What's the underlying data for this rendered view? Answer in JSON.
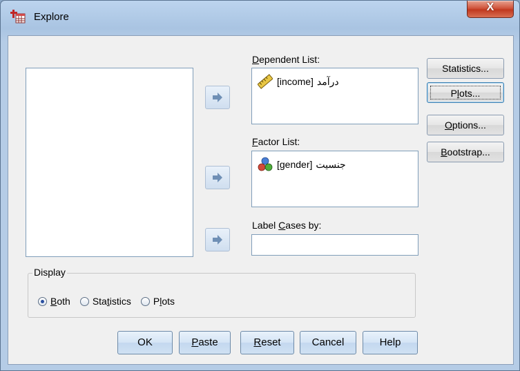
{
  "window": {
    "title": "Explore",
    "close_glyph": "X"
  },
  "source_list": {
    "items": []
  },
  "dependent_list": {
    "label_pre": "",
    "label_ul": "D",
    "label_post": "ependent List:",
    "items": [
      {
        "var": "[income]",
        "label": "درآمد",
        "icon": "ruler-scale-icon"
      }
    ]
  },
  "factor_list": {
    "label_pre": "",
    "label_ul": "F",
    "label_post": "actor List:",
    "items": [
      {
        "var": "[gender]",
        "label": "جنسیت",
        "icon": "nominal-balls-icon"
      }
    ]
  },
  "label_cases": {
    "label_pre": "Label ",
    "label_ul": "C",
    "label_post": "ases by:",
    "value": ""
  },
  "side_buttons": {
    "statistics": "Statistics...",
    "plots_pre": "P",
    "plots_ul": "l",
    "plots_post": "ots...",
    "options_pre": "",
    "options_ul": "O",
    "options_post": "ptions...",
    "bootstrap_pre": "",
    "bootstrap_ul": "B",
    "bootstrap_post": "ootstrap..."
  },
  "display": {
    "legend": "Display",
    "both_ul": "B",
    "both_post": "oth",
    "statistics_pre": "Sta",
    "statistics_ul": "t",
    "statistics_post": "istics",
    "plots_pre": "P",
    "plots_ul": "l",
    "plots_post": "ots",
    "selected": "both"
  },
  "bottom_buttons": {
    "ok": "OK",
    "paste_ul": "P",
    "paste_post": "aste",
    "reset_ul": "R",
    "reset_post": "eset",
    "cancel": "Cancel",
    "help": "Help"
  },
  "colors": {
    "accent": "#3c7fb1",
    "title_bg": "#b5cce6",
    "close": "#c0391f"
  }
}
